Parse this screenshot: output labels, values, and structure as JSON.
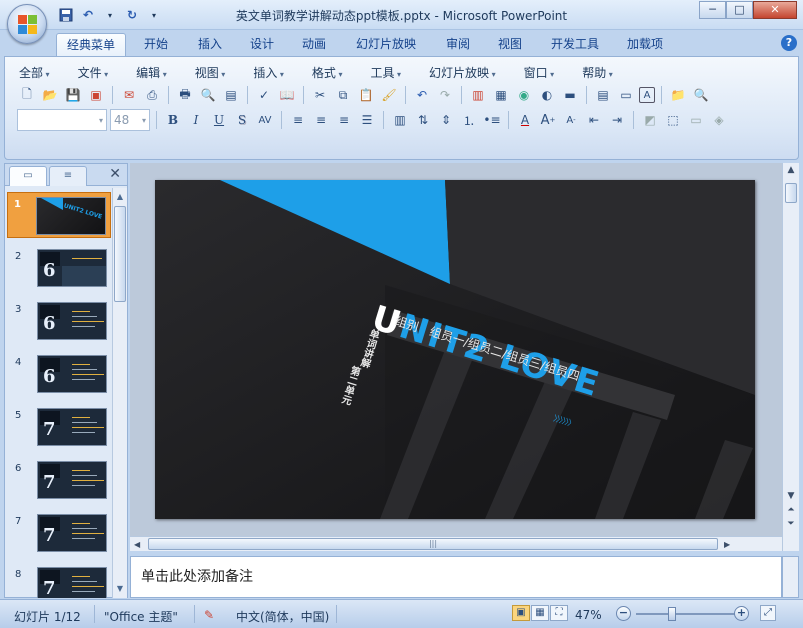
{
  "window": {
    "title": "英文单词教学讲解动态ppt模板.pptx - Microsoft PowerPoint",
    "minimize": "─",
    "maximize": "□",
    "close": "✕"
  },
  "tabs": [
    "经典菜单",
    "开始",
    "插入",
    "设计",
    "动画",
    "幻灯片放映",
    "审阅",
    "视图",
    "开发工具",
    "加载项"
  ],
  "active_tab": "经典菜单",
  "menu": [
    "全部",
    "文件",
    "编辑",
    "视图",
    "插入",
    "格式",
    "工具",
    "幻灯片放映",
    "窗口",
    "帮助"
  ],
  "format": {
    "font_name": "",
    "font_size": "48",
    "bold": "B",
    "italic": "I",
    "underline": "U",
    "shadow": "S",
    "font_color": "A"
  },
  "thumbnails": {
    "numbers": [
      "1",
      "2",
      "3",
      "4",
      "5",
      "6",
      "7",
      "8"
    ],
    "digits": [
      "",
      "6",
      "6",
      "6",
      "7",
      "7",
      "7",
      "7"
    ],
    "selected": "1"
  },
  "slide": {
    "title_prefix": "U",
    "title_rest": "NIT2  LOVE",
    "members": "组别　组员一/组员二/组员三/组员四",
    "vertical_1": "单词讲解",
    "vertical_2": "第二单元",
    "chevrons": "〉〉〉〉〉〉",
    "accent_color": "#1e9fe8",
    "bg_color": "#1f1f21"
  },
  "notes": {
    "placeholder": "单击此处添加备注"
  },
  "status": {
    "slide_info": "幻灯片 1/12",
    "theme": "\"Office 主题\"",
    "language": "中文(简体，中国)",
    "zoom": "47%",
    "zoom_fraction": 0.35
  },
  "colors": {
    "ribbon_bg": "#dbe7f6",
    "selected_thumb": "#f0a040"
  }
}
